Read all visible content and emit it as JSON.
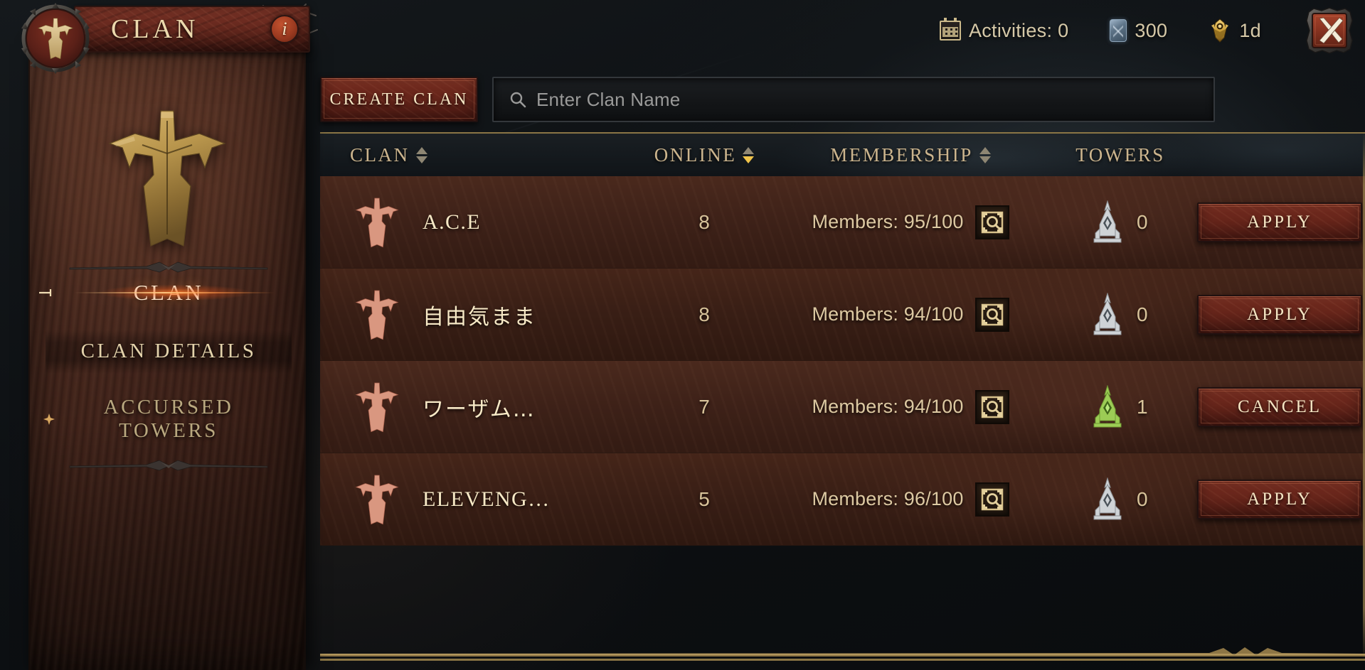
{
  "window": {
    "title": "CLAN",
    "info_icon": "info-icon",
    "close_icon": "close-x-icon"
  },
  "hud": {
    "activities": {
      "icon": "calendar-icon",
      "label": "Activities: 0"
    },
    "currency": {
      "icon": "hilts-icon",
      "value": "300"
    },
    "rank": {
      "icon": "rank-crest-icon",
      "value": "1d"
    }
  },
  "sidebar": {
    "emblem_icon": "clan-emblem-icon",
    "items": [
      {
        "label": "CLAN",
        "active": true,
        "marker": "arrow-marker-icon"
      },
      {
        "label": "CLAN DETAILS",
        "active": false,
        "marker": ""
      },
      {
        "label": "ACCURSED\nTOWERS",
        "active": false,
        "marker": "cross-marker-icon"
      }
    ]
  },
  "toolbar": {
    "create_clan_label": "CREATE CLAN",
    "search": {
      "icon": "search-icon",
      "placeholder": "Enter Clan Name",
      "value": ""
    }
  },
  "table": {
    "columns": [
      {
        "label": "CLAN",
        "sortable": true,
        "sort": "none"
      },
      {
        "label": "ONLINE",
        "sortable": true,
        "sort": "desc"
      },
      {
        "label": "MEMBERSHIP",
        "sortable": true,
        "sort": "none"
      },
      {
        "label": "TOWERS",
        "sortable": false,
        "sort": "none"
      }
    ],
    "rows": [
      {
        "sigil": "clan-sigil-icon",
        "name": "A.C.E",
        "cjk": false,
        "online": "8",
        "membership": "Members: 95/100",
        "inspect_icon": "inspect-magnifier-icon",
        "tower_icon": "tower-icon",
        "tower_owned": false,
        "towers": "0",
        "action": "APPLY"
      },
      {
        "sigil": "clan-sigil-icon",
        "name": "自由気まま",
        "cjk": true,
        "online": "8",
        "membership": "Members: 94/100",
        "inspect_icon": "inspect-magnifier-icon",
        "tower_icon": "tower-icon",
        "tower_owned": false,
        "towers": "0",
        "action": "APPLY"
      },
      {
        "sigil": "clan-sigil-icon",
        "name": "ワーザム…",
        "cjk": true,
        "online": "7",
        "membership": "Members: 94/100",
        "inspect_icon": "inspect-magnifier-icon",
        "tower_icon": "tower-icon",
        "tower_owned": true,
        "towers": "1",
        "action": "CANCEL"
      },
      {
        "sigil": "clan-sigil-icon",
        "name": "ELEVENG…",
        "cjk": false,
        "online": "5",
        "membership": "Members: 96/100",
        "inspect_icon": "inspect-magnifier-icon",
        "tower_icon": "tower-icon",
        "tower_owned": false,
        "towers": "0",
        "action": "APPLY"
      }
    ]
  },
  "colors": {
    "gold": "#cbb48d",
    "gold_bright": "#f0c44a",
    "parchment": "#f7e9c6",
    "red_button": "#722a1e",
    "panel_brown": "#3d2118",
    "tower_active": "#9ccc55",
    "tower_inactive": "#cfd3d6"
  }
}
